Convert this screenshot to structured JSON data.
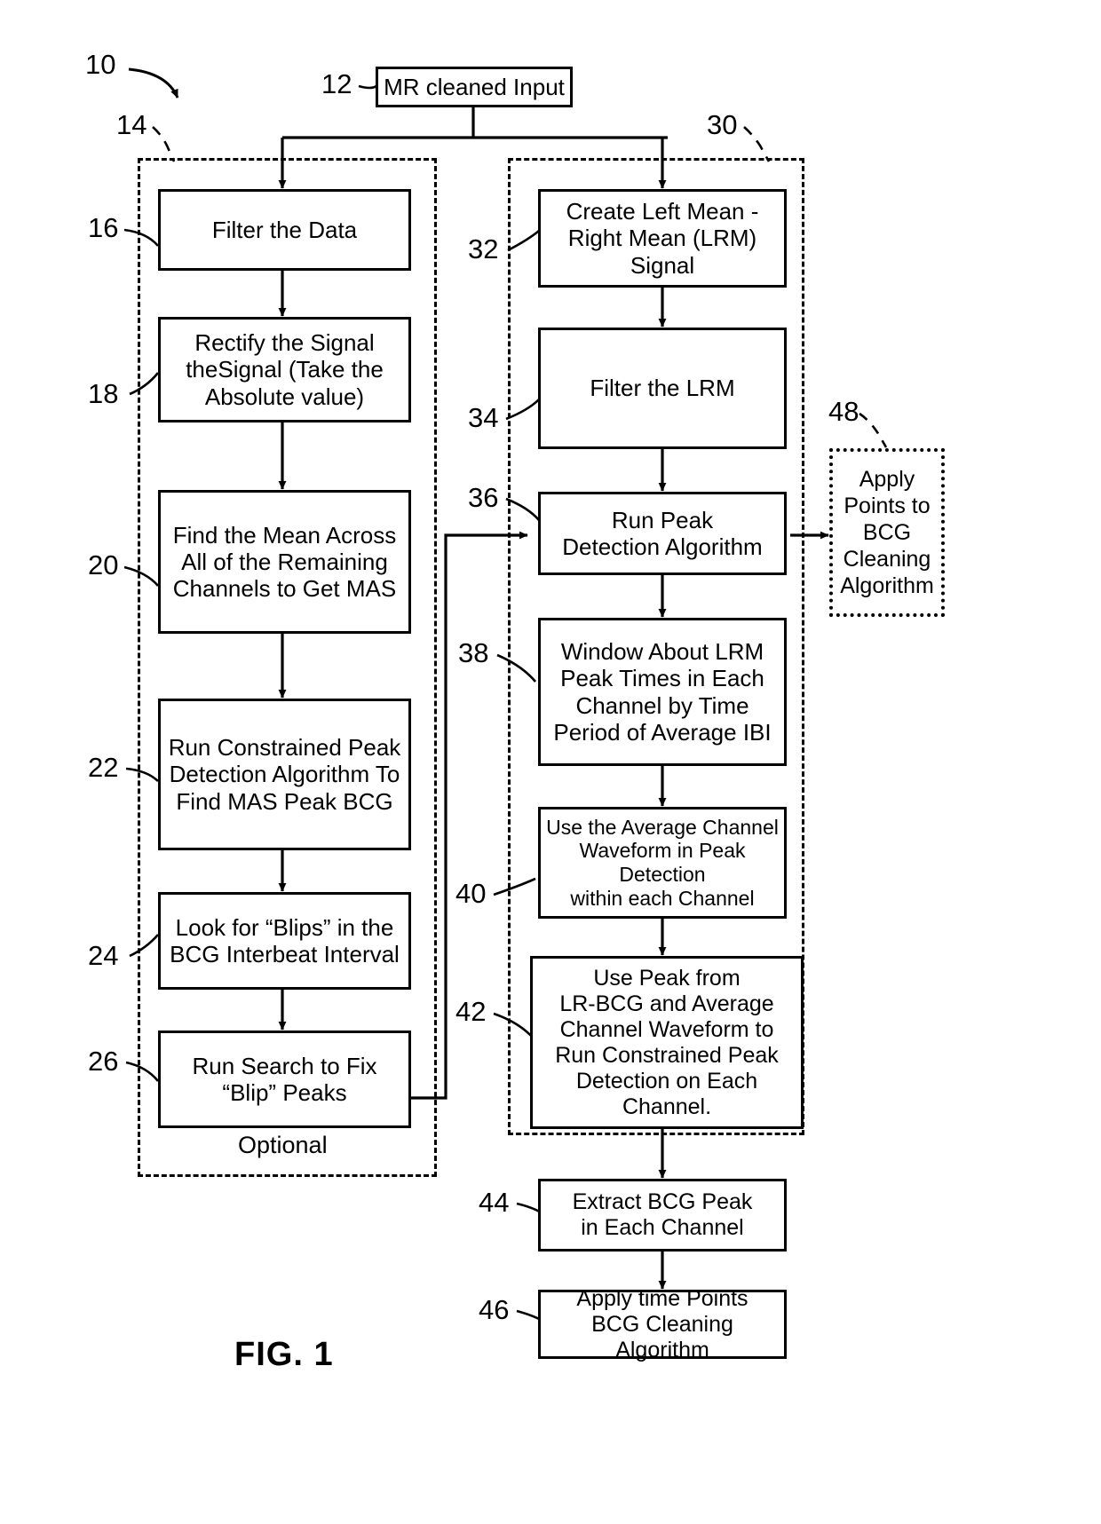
{
  "figure": {
    "caption": "FIG. 1",
    "optional_label": "Optional"
  },
  "reference_numerals": {
    "n10": "10",
    "n12": "12",
    "n14": "14",
    "n16": "16",
    "n18": "18",
    "n20": "20",
    "n22": "22",
    "n24": "24",
    "n26": "26",
    "n30": "30",
    "n32": "32",
    "n34": "34",
    "n36": "36",
    "n38": "38",
    "n40": "40",
    "n42": "42",
    "n44": "44",
    "n46": "46",
    "n48": "48"
  },
  "boxes": {
    "input": "MR cleaned Input",
    "filter_data": "Filter the Data",
    "rectify": "Rectify the Signal\ntheSignal (Take the\nAbsolute value)",
    "find_mean": "Find the Mean Across\nAll of the Remaining\nChannels to Get MAS",
    "constrained_peak": "Run Constrained Peak\nDetection Algorithm To\nFind MAS Peak BCG",
    "look_blips": "Look for “Blips” in the\nBCG Interbeat Interval",
    "fix_blips": "Run Search to Fix\n“Blip” Peaks",
    "create_lrm": "Create Left Mean -\nRight Mean (LRM) Signal",
    "filter_lrm": "Filter the LRM",
    "run_peak_detection": "Run Peak\nDetection Algorithm",
    "window_lrm": "Window About LRM\nPeak Times in Each\nChannel by Time\nPeriod of Average IBI",
    "avg_channel_waveform": "Use the Average Channel\nWaveform in Peak Detection\nwithin each Channel",
    "use_peak_lrbcg": "Use Peak from\nLR-BCG and Average\nChannel Waveform to\nRun Constrained Peak\nDetection on Each Channel.",
    "extract_bcg_peak": "Extract BCG Peak\nin Each Channel",
    "apply_time_points": "Apply time Points\nBCG Cleaning Algorithm",
    "apply_points_bcg": "Apply\nPoints to\nBCG\nCleaning\nAlgorithm"
  },
  "colors": {
    "ink": "#000000",
    "paper": "#ffffff"
  }
}
